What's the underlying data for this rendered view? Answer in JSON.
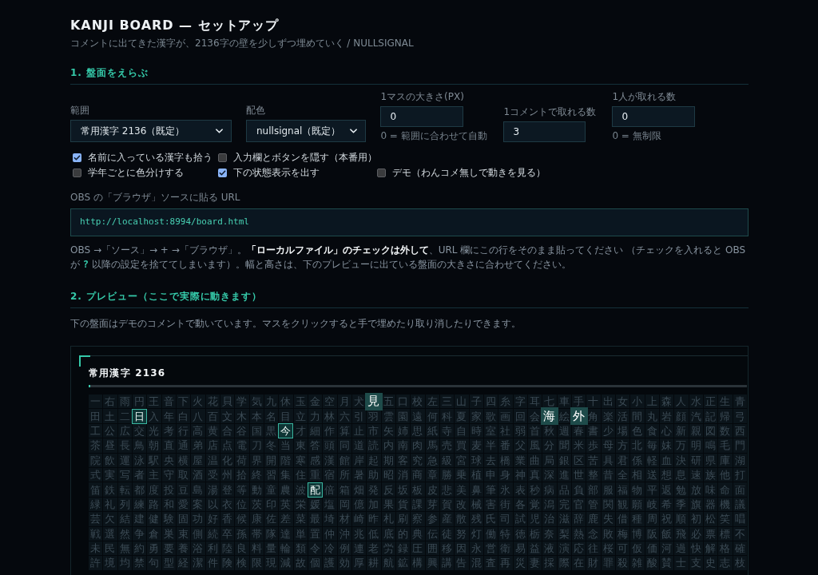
{
  "header": {
    "title": "KANJI BOARD — セットアップ",
    "subtitle": "コメントに出てきた漢字が、2136字の壁を少しずつ埋めていく / NULLSIGNAL"
  },
  "section_1": {
    "heading": "1. 盤面をえらぶ",
    "fields": [
      {
        "kind": "select",
        "label": "範囲",
        "value": "常用漢字 2136（既定）"
      },
      {
        "kind": "select",
        "label": "配色",
        "value": "nullsignal（既定）"
      },
      {
        "kind": "number",
        "label": "1マスの大きさ(PX)",
        "value": "0",
        "hint": "0 = 範囲に合わせて自動"
      },
      {
        "kind": "number",
        "label": "1コメントで取れる数",
        "value": "3"
      },
      {
        "kind": "number",
        "label": "1人が取れる数",
        "value": "0",
        "hint": "0 = 無制限"
      }
    ],
    "option_rows": [
      [
        {
          "label": "名前に入っている漢字も拾う",
          "checked": true
        },
        {
          "label": "入力欄とボタンを隠す（本番用）",
          "checked": false
        }
      ],
      [
        {
          "label": "学年ごとに色分けする",
          "checked": false
        },
        {
          "label": "下の状態表示を出す",
          "checked": true
        },
        {
          "label": "デモ（わんコメ無しで動きを見る）",
          "checked": false
        }
      ]
    ],
    "url": {
      "label": "OBS の「ブラウザ」ソースに貼る URL",
      "value": "http://localhost:8994/board.html"
    },
    "note": [
      {
        "kind": "text",
        "text": "OBS →「ソース」→ + →「ブラウザ」。"
      },
      {
        "kind": "strong",
        "text": "「ローカルファイル」のチェックは外して"
      },
      {
        "kind": "text",
        "text": "、URL 欄にこの行をそのまま貼ってください （チェックを入れると OBS が "
      },
      {
        "kind": "code",
        "text": "?"
      },
      {
        "kind": "text",
        "text": " 以降の設定を捨ててしまいます）。幅と高さは、下のプレビューに出ている盤面の大きさに合わせてください。"
      }
    ]
  },
  "section_2": {
    "heading": "2. プレビュー（ここで実際に動きます）",
    "description": "下の盤面はデモのコメントで動いています。マスをクリックすると手で埋めたり取り消したりできます。",
    "board": {
      "title": "常用漢字 2136",
      "progress": {
        "level": 0.003
      },
      "rows": [
        {
          "segments": [
            {
              "text": "一右雨円王音下火花貝学気九休玉金空月犬",
              "kind": "open"
            },
            {
              "text": "見",
              "kind": "new"
            },
            {
              "text": "五口校左三山子四糸字耳七車手十出女小上森人水正生青",
              "kind": "open"
            }
          ]
        },
        {
          "segments": [
            {
              "text": "田土二",
              "kind": "open"
            },
            {
              "text": "日",
              "kind": "claimed"
            },
            {
              "text": "入年白八百文木本名目立力林六引羽雲園遠何科夏家歌画回会",
              "kind": "open"
            },
            {
              "text": "海",
              "kind": "new"
            },
            {
              "text": "絵",
              "kind": "open"
            },
            {
              "text": "外",
              "kind": "new"
            },
            {
              "text": "角楽活間丸岩顔汽記帰弓",
              "kind": "open"
            }
          ]
        },
        {
          "segments": [
            {
              "text": "工公広交光考行高黄合谷国黒",
              "kind": "open"
            },
            {
              "text": "今",
              "kind": "claimed"
            },
            {
              "text": "才細作算止市矢姉思紙寺自時室社弱首秋週春書少場色食心新親図数西",
              "kind": "open"
            }
          ]
        },
        {
          "segments": [
            {
              "text": "茶昼長鳥朝直通弟店点電刀冬当東答頭同道読内南肉馬売買麦半番父風分聞米歩母方北毎妹万明鳴毛門",
              "kind": "open"
            }
          ]
        },
        {
          "segments": [
            {
              "text": "院飲運泳駅央横屋温化荷界開階寒感漢館岸起期客究急級宮球去橋業曲局銀区苦具君係軽血決研県庫湖",
              "kind": "open"
            }
          ]
        },
        {
          "segments": [
            {
              "text": "式実写者主守取酒受州拾終習集住重宿所暑助昭消商章勝乗植申身神真深進世整昔全相送想息速族他打",
              "kind": "open"
            }
          ]
        },
        {
          "segments": [
            {
              "text": "笛鉄転都度投豆島湯登等動童農波",
              "kind": "open"
            },
            {
              "text": "配",
              "kind": "claimed"
            },
            {
              "text": "倍箱畑発反坂板皮悲美鼻筆氷表秒病品負部服福物平返勉放味命面",
              "kind": "open"
            }
          ]
        },
        {
          "segments": [
            {
              "text": "緑礼列練路和愛案以衣位茨印英栄媛塩岡億加果貨課芽賀改械害街各覚潟完官管関観願岐希季旗器機議",
              "kind": "open"
            }
          ]
        },
        {
          "segments": [
            {
              "text": "芸欠結建健験固功好香候康佐差菜最埼材崎昨札刷察参産散残氏司試児治滋辞鹿失借種周祝順初松笑唱",
              "kind": "open"
            }
          ]
        },
        {
          "segments": [
            {
              "text": "戦選然争倉巣束側続卒孫帯隊達単置仲沖兆低底的典伝徒努灯働特徳栃奈梨熱念敗梅博阪飯飛必票標不",
              "kind": "open"
            }
          ]
        },
        {
          "segments": [
            {
              "text": "未民無約勇要養浴利陸良料量輪類令冷例連老労録圧囲移因永営衛易益液演応往桜可仮価河過快解格確",
              "kind": "open"
            }
          ]
        },
        {
          "segments": [
            {
              "text": "許境均禁句型経潔件険検限現減故個護効厚耕航鉱構興講告混査再災妻採際在財罪殺雑酸賛士支史志枝",
              "kind": "open"
            }
          ]
        }
      ]
    }
  }
}
